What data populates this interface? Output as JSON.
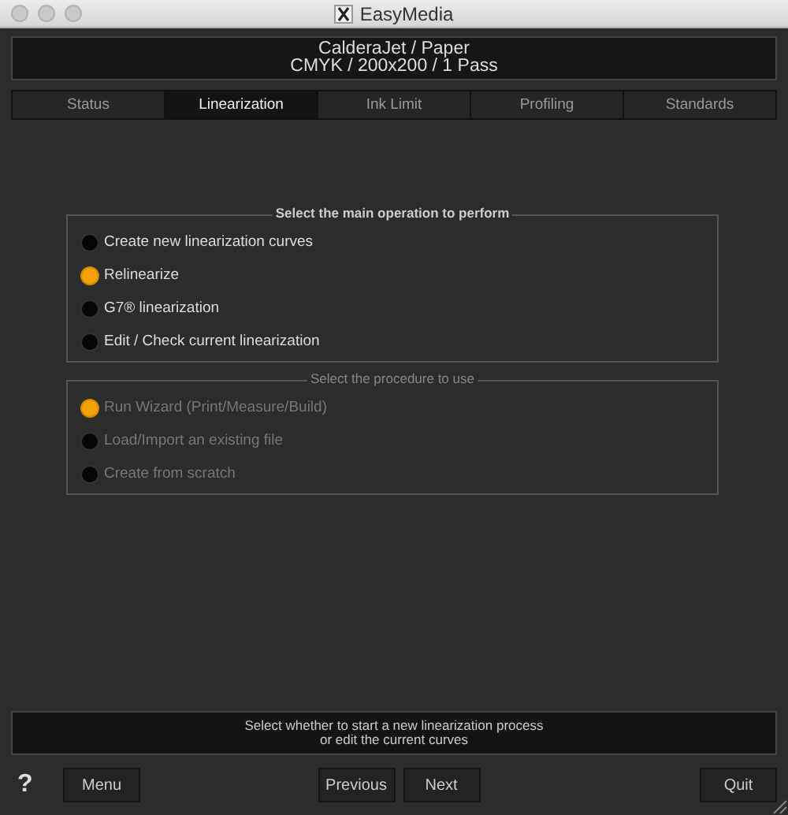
{
  "window": {
    "title": "EasyMedia"
  },
  "header": {
    "lines": [
      "CalderaJet / Paper",
      "CMYK / 200x200 / 1 Pass"
    ]
  },
  "tabs": [
    {
      "label": "Status",
      "selected": false
    },
    {
      "label": "Linearization",
      "selected": true
    },
    {
      "label": "Ink Limit",
      "selected": false
    },
    {
      "label": "Profiling",
      "selected": false
    },
    {
      "label": "Standards",
      "selected": false
    }
  ],
  "groups": [
    {
      "title": "Select the main operation to perform",
      "disabled": false,
      "options": [
        {
          "label": "Create new linearization curves",
          "selected": false
        },
        {
          "label": "Relinearize",
          "selected": true
        },
        {
          "label": "G7® linearization",
          "selected": false
        },
        {
          "label": "Edit / Check current linearization",
          "selected": false
        }
      ]
    },
    {
      "title": "Select the procedure to use",
      "disabled": true,
      "options": [
        {
          "label": "Run Wizard (Print/Measure/Build)",
          "selected": true
        },
        {
          "label": "Load/Import an existing file",
          "selected": false
        },
        {
          "label": "Create from scratch",
          "selected": false
        }
      ]
    }
  ],
  "status_bar": {
    "lines": [
      "Select whether to start a new linearization process",
      "or edit the current curves"
    ]
  },
  "help": "?",
  "buttons": [
    {
      "label": "Menu",
      "kind": "left"
    },
    {
      "label": "Previous",
      "kind": "center"
    },
    {
      "label": "Next",
      "kind": "center"
    },
    {
      "label": "Quit",
      "kind": "right"
    }
  ]
}
